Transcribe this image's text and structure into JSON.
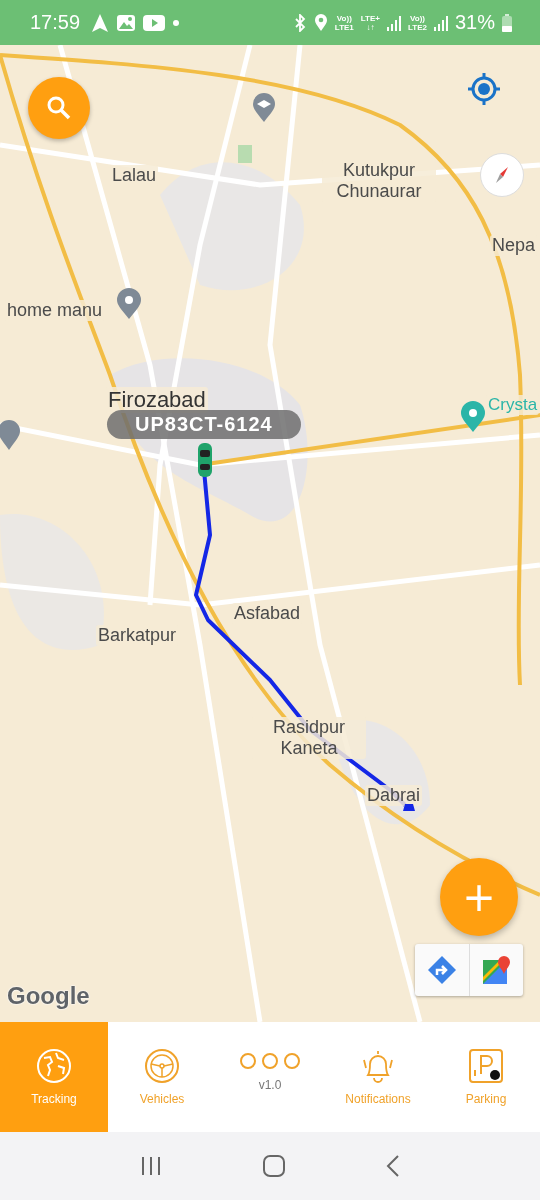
{
  "status_bar": {
    "time": "17:59",
    "sim_1": [
      "Vo))",
      "LTE1"
    ],
    "network": [
      "LTE+",
      "↓↑"
    ],
    "sim_2": [
      "Vo))",
      "LTE2"
    ],
    "battery": "31%"
  },
  "map": {
    "places": [
      "Lalau",
      "Kutukpur Chunaurar",
      "Nepa",
      "home manu",
      "Firozabad",
      "Crysta",
      "Asfabad",
      "Barkatpur",
      "Rasidpur Kaneta",
      "Dabrai"
    ],
    "vehicle_label": "UP83CT-6124",
    "attribution": "Google",
    "add_button": "+"
  },
  "bottom_nav": [
    {
      "label": "Tracking",
      "selected": true
    },
    {
      "label": "Vehicles",
      "selected": false
    },
    {
      "label": "v1.0",
      "selected": false
    },
    {
      "label": "Notifications",
      "selected": false
    },
    {
      "label": "Parking",
      "selected": false
    }
  ]
}
